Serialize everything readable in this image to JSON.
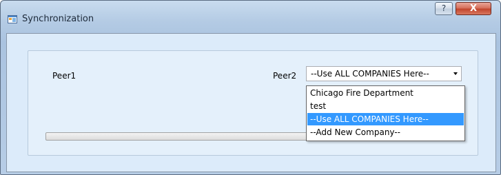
{
  "window": {
    "title": "Synchronization",
    "help_label": "?",
    "close_label": "X"
  },
  "form": {
    "peer1_label": "Peer1",
    "peer2_label": "Peer2",
    "peer2_selected": "--Use ALL COMPANIES Here--",
    "progress": 0
  },
  "dropdown": {
    "options": [
      "Chicago Fire Department",
      "test",
      "--Use ALL COMPANIES Here--",
      "--Add New Company--"
    ],
    "highlighted_index": 2
  },
  "colors": {
    "selection": "#3399ff",
    "client_background": "#dcebfa",
    "close_button": "#c0432b"
  },
  "icons": [
    "window-app-icon",
    "dropdown-arrow-icon"
  ]
}
